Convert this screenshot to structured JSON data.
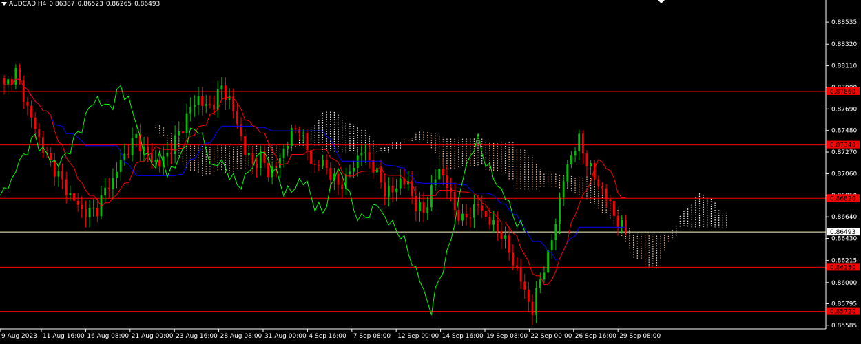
{
  "header": {
    "symbol": "AUDCAD,H4",
    "open": "0.86387",
    "high": "0.86523",
    "low": "0.86265",
    "close": "0.86493"
  },
  "colors": {
    "background": "#000000",
    "bull": "#00c000",
    "bear": "#ff0000",
    "kijun": "#0000ff",
    "tenkan": "#ff0000",
    "chikou": "#00ff00",
    "cloud_bull": "#ffffff",
    "cloud_bear": "#ffc8a0",
    "level_line": "#ff0000",
    "current_line": "#ffffc0",
    "level_tag": "#ff0000"
  },
  "chart_data": {
    "type": "candlestick",
    "ylim": [
      0.8555,
      0.8875
    ],
    "y_ticks": [
      "0.88535",
      "0.88320",
      "0.88110",
      "0.87900",
      "0.87690",
      "0.87480",
      "0.87270",
      "0.87060",
      "0.86850",
      "0.86640",
      "0.86430",
      "0.86215",
      "0.86000",
      "0.85795",
      "0.85585"
    ],
    "x_ticks": [
      "9 Aug 2023",
      "11 Aug 16:00",
      "16 Aug 08:00",
      "21 Aug 00:00",
      "23 Aug 16:00",
      "28 Aug 08:00",
      "31 Aug 00:00",
      "4 Sep 16:00",
      "7 Sep 08:00",
      "12 Sep 00:00",
      "14 Sep 16:00",
      "19 Sep 08:00",
      "22 Sep 00:00",
      "26 Sep 16:00",
      "29 Sep 08:00"
    ],
    "levels": [
      {
        "value": 0.8786,
        "label": "0.87860"
      },
      {
        "value": 0.8734,
        "label": "0.87340"
      },
      {
        "value": 0.8682,
        "label": "0.86820"
      },
      {
        "value": 0.8615,
        "label": "0.86150"
      },
      {
        "value": 0.8572,
        "label": "0.85720"
      }
    ],
    "current_price": {
      "value": 0.86493,
      "label": "0.86493"
    },
    "close_path": [
      [
        0,
        0.879
      ],
      [
        3,
        0.8805
      ],
      [
        6,
        0.877
      ],
      [
        9,
        0.874
      ],
      [
        11,
        0.8722
      ],
      [
        14,
        0.8705
      ],
      [
        16,
        0.869
      ],
      [
        18,
        0.868
      ],
      [
        20,
        0.867
      ],
      [
        22,
        0.8668
      ],
      [
        24,
        0.8672
      ],
      [
        26,
        0.869
      ],
      [
        28,
        0.87
      ],
      [
        30,
        0.8718
      ],
      [
        32,
        0.873
      ],
      [
        34,
        0.8742
      ],
      [
        36,
        0.8728
      ],
      [
        38,
        0.872
      ],
      [
        40,
        0.8715
      ],
      [
        42,
        0.8725
      ],
      [
        44,
        0.8738
      ],
      [
        46,
        0.8752
      ],
      [
        48,
        0.877
      ],
      [
        50,
        0.878
      ],
      [
        52,
        0.877
      ],
      [
        54,
        0.8775
      ],
      [
        56,
        0.879
      ],
      [
        58,
        0.8778
      ],
      [
        60,
        0.8755
      ],
      [
        62,
        0.8728
      ],
      [
        64,
        0.8715
      ],
      [
        66,
        0.8722
      ],
      [
        68,
        0.8708
      ],
      [
        70,
        0.8712
      ],
      [
        72,
        0.873
      ],
      [
        74,
        0.8745
      ],
      [
        76,
        0.8752
      ],
      [
        78,
        0.8728
      ],
      [
        80,
        0.8712
      ],
      [
        82,
        0.8718
      ],
      [
        84,
        0.8705
      ],
      [
        86,
        0.8695
      ],
      [
        88,
        0.87
      ],
      [
        90,
        0.8715
      ],
      [
        92,
        0.8728
      ],
      [
        94,
        0.872
      ],
      [
        96,
        0.8705
      ],
      [
        98,
        0.869
      ],
      [
        100,
        0.8688
      ],
      [
        102,
        0.87
      ],
      [
        104,
        0.8695
      ],
      [
        106,
        0.8675
      ],
      [
        108,
        0.8668
      ],
      [
        110,
        0.869
      ],
      [
        112,
        0.8712
      ],
      [
        114,
        0.8695
      ],
      [
        116,
        0.8672
      ],
      [
        118,
        0.866
      ],
      [
        120,
        0.8668
      ],
      [
        122,
        0.8676
      ],
      [
        124,
        0.8664
      ],
      [
        126,
        0.8655
      ],
      [
        128,
        0.8648
      ],
      [
        130,
        0.863
      ],
      [
        132,
        0.8612
      ],
      [
        134,
        0.8592
      ],
      [
        136,
        0.8572
      ],
      [
        138,
        0.8605
      ],
      [
        140,
        0.8625
      ],
      [
        142,
        0.866
      ],
      [
        144,
        0.87
      ],
      [
        146,
        0.8725
      ],
      [
        148,
        0.8738
      ],
      [
        150,
        0.8718
      ],
      [
        152,
        0.8702
      ],
      [
        154,
        0.869
      ],
      [
        156,
        0.8676
      ],
      [
        158,
        0.8658
      ],
      [
        160,
        0.8649
      ]
    ],
    "ichimoku": {
      "tenkan": 9,
      "kijun": 26,
      "senkou_b": 52,
      "shift": 26
    }
  }
}
